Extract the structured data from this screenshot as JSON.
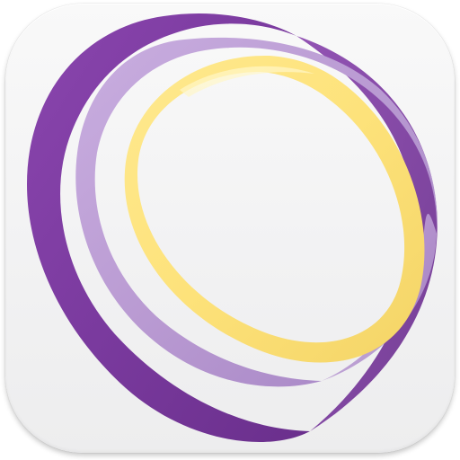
{
  "app_icon": {
    "icon_name": "concentric-swirl-rings-logo-icon",
    "colors": {
      "tile_background": "#f3f3f4",
      "outer_ring": "#7a3a9e",
      "middle_ring": "#b99ad2",
      "inner_ring": "#fde27a"
    }
  }
}
